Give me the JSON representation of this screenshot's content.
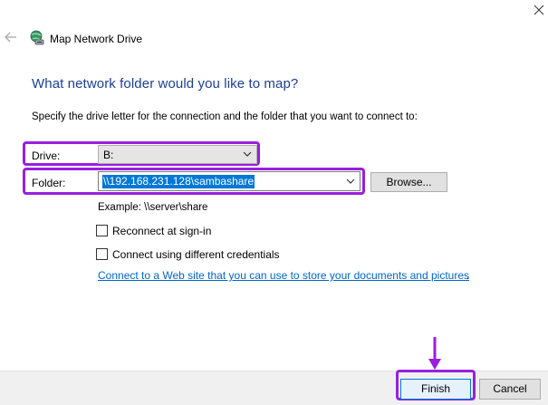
{
  "window": {
    "title": "Map Network Drive",
    "close_icon": "close-icon",
    "back_icon": "back-arrow-icon",
    "title_icon": "network-drive-icon"
  },
  "main": {
    "heading": "What network folder would you like to map?",
    "instructions": "Specify the drive letter for the connection and the folder that you want to connect to:",
    "drive": {
      "label": "Drive:",
      "value": "B:"
    },
    "folder": {
      "label": "Folder:",
      "value": "\\\\192.168.231.128\\sambashare",
      "browse_label": "Browse..."
    },
    "example": "Example: \\\\server\\share",
    "checkboxes": [
      {
        "label": "Reconnect at sign-in",
        "checked": false
      },
      {
        "label": "Connect using different credentials",
        "checked": false
      }
    ],
    "link_text": "Connect to a Web site that you can use to store your documents and pictures",
    "link_suffix": "."
  },
  "footer": {
    "finish_label": "Finish",
    "cancel_label": "Cancel"
  },
  "colors": {
    "heading": "#1c3f94",
    "highlight": "#9a1ee0",
    "link": "#0066cc",
    "selection": "#0078d7"
  }
}
